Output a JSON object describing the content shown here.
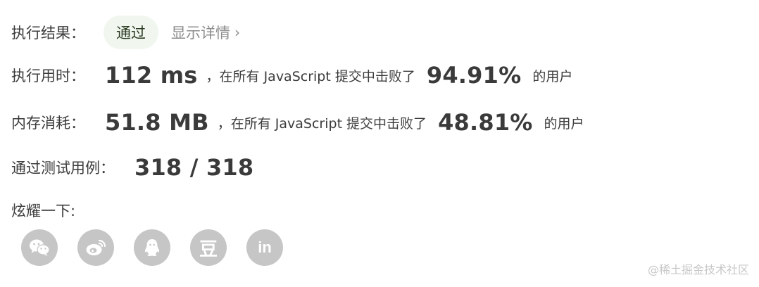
{
  "result": {
    "label": "执行结果：",
    "status": "通过",
    "details_link": "显示详情",
    "chevron": "›"
  },
  "runtime": {
    "label": "执行用时：",
    "value": "112 ms",
    "middle": "，在所有 JavaScript 提交中击败了",
    "percent": "94.91%",
    "suffix": "的用户"
  },
  "memory": {
    "label": "内存消耗：",
    "value": "51.8 MB",
    "middle": "，在所有 JavaScript 提交中击败了",
    "percent": "48.81%",
    "suffix": "的用户"
  },
  "testcases": {
    "label": "通过测试用例：",
    "value": "318 / 318"
  },
  "share": {
    "label": "炫耀一下:",
    "icons": [
      "wechat-icon",
      "weibo-icon",
      "qq-icon",
      "douban-icon",
      "linkedin-icon"
    ],
    "douban_glyph": "豆",
    "linkedin_glyph": "in"
  },
  "watermark": "@稀土掘金技术社区",
  "colors": {
    "badge_bg": "#f1f7ef",
    "icon_bg": "#c6c6c6",
    "muted_text": "#8c8c8c"
  }
}
